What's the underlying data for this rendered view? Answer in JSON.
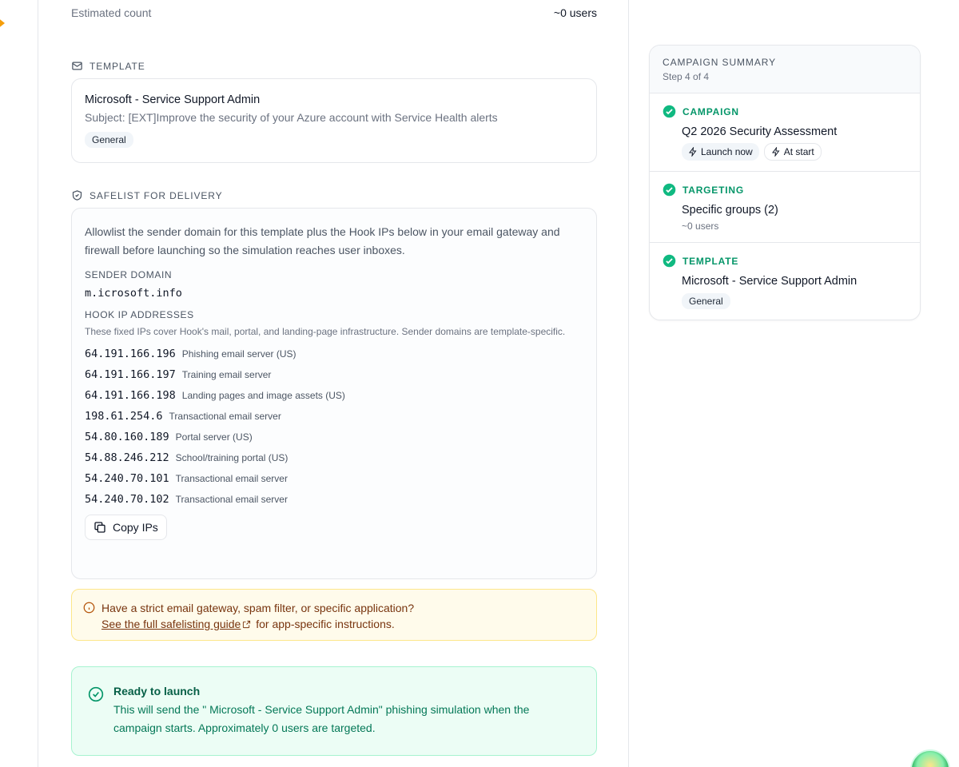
{
  "estimated": {
    "label": "Estimated count",
    "value": "~0 users"
  },
  "template_section": {
    "heading": "TEMPLATE",
    "name": "Microsoft - Service Support Admin",
    "subject": "Subject: [EXT]Improve the security of your Azure account with Service Health alerts",
    "tag": "General"
  },
  "safelist": {
    "heading": "SAFELIST FOR DELIVERY",
    "description": "Allowlist the sender domain for this template plus the Hook IPs below in your email gateway and firewall before launching so the simulation reaches user inboxes.",
    "sender_label": "SENDER DOMAIN",
    "sender_domain": "m.icrosoft.info",
    "hook_label": "HOOK IP ADDRESSES",
    "hook_note": "These fixed IPs cover Hook's mail, portal, and landing-page infrastructure. Sender domains are template-specific.",
    "ips": [
      {
        "ip": "64.191.166.196",
        "desc": "Phishing email server (US)"
      },
      {
        "ip": "64.191.166.197",
        "desc": "Training email server"
      },
      {
        "ip": "64.191.166.198",
        "desc": "Landing pages and image assets (US)"
      },
      {
        "ip": "198.61.254.6",
        "desc": "Transactional email server"
      },
      {
        "ip": "54.80.160.189",
        "desc": "Portal server (US)"
      },
      {
        "ip": "54.88.246.212",
        "desc": "School/training portal (US)"
      },
      {
        "ip": "54.240.70.101",
        "desc": "Transactional email server"
      },
      {
        "ip": "54.240.70.102",
        "desc": "Transactional email server"
      }
    ],
    "copy_button": "Copy IPs"
  },
  "warning": {
    "line1": "Have a strict email gateway, spam filter, or specific application?",
    "link": "See the full safelisting guide",
    "line2_rest": " for app-specific instructions."
  },
  "ready": {
    "title": "Ready to launch",
    "body": "This will send the \" Microsoft - Service Support Admin\" phishing simulation when the campaign starts. Approximately 0 users are targeted."
  },
  "summary": {
    "title": "CAMPAIGN SUMMARY",
    "step": "Step 4 of 4",
    "campaign": {
      "heading": "CAMPAIGN",
      "name": "Q2 2026 Security Assessment",
      "chip1": "Launch now",
      "chip2": "At start"
    },
    "targeting": {
      "heading": "TARGETING",
      "value": "Specific groups (2)",
      "sub": "~0 users"
    },
    "template": {
      "heading": "TEMPLATE",
      "value": "Microsoft - Service Support Admin",
      "tag": "General"
    }
  },
  "colors": {
    "accent_green": "#059669",
    "warn_bg": "#fffbeb",
    "ready_bg": "#ecfdf5"
  }
}
